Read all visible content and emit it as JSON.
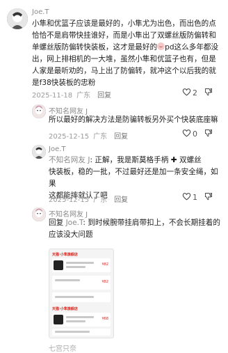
{
  "comments": [
    {
      "author": "Joe.T",
      "lines": [
        "小隼和优篮子应该是最好的，小隼尤为出色，而出色的点",
        "恰恰不是肩带快挂谁好，而是小隼出了双螺丝版防偏转和",
        "单螺丝版防偏转快装板，这才是最好的",
        "pd这么多年都没",
        "出，网上排相机的一大堆，虽然小隼和优篮子也有，但是",
        "人家是最听劝的，马上出了防偏转，就冲这个以后我的就",
        "是f38快装板的忠粉"
      ],
      "date": "2025-11-18",
      "location": "广东",
      "reply": "回复",
      "likes": "2"
    },
    {
      "author": "不知名网友 J",
      "lines": [
        "所以最好的解决方法是防骗转板另外买个快装底座嘛"
      ],
      "date": "2025-12-15",
      "location": "广东",
      "reply": "回复",
      "likes": "0"
    },
    {
      "author": "Joe.T",
      "mention": "不知名网友 J",
      "lines": [
        ": 正解，我是斯莫格手柄",
        "双螺丝",
        "快装板，稳的一批，不过最好还是加一条安全绳，如果",
        "这都能摔就认了吧"
      ],
      "date": "2025-12-15",
      "location": "广东",
      "reply": "回复",
      "likes": "1"
    },
    {
      "author": "不知名网友 J",
      "reply_prefix": "回复",
      "mention": "Joe.T",
      "lines": [
        ": 到时候腕带挂肩带扣上，不会长期挂着的",
        "应该没大问题"
      ]
    }
  ],
  "next_author": "七宫只奈",
  "screenshot": {
    "store": "天猫·小隼旗舰店",
    "items": [
      {
        "price": "¥82"
      },
      {
        "price": "¥82"
      },
      {
        "price": "¥68"
      }
    ]
  },
  "icons": {
    "like": "heart-icon",
    "dislike": "thumbs-down-icon"
  },
  "colors": {
    "meta": "#9a9a9a",
    "name": "#8a8a8a"
  }
}
